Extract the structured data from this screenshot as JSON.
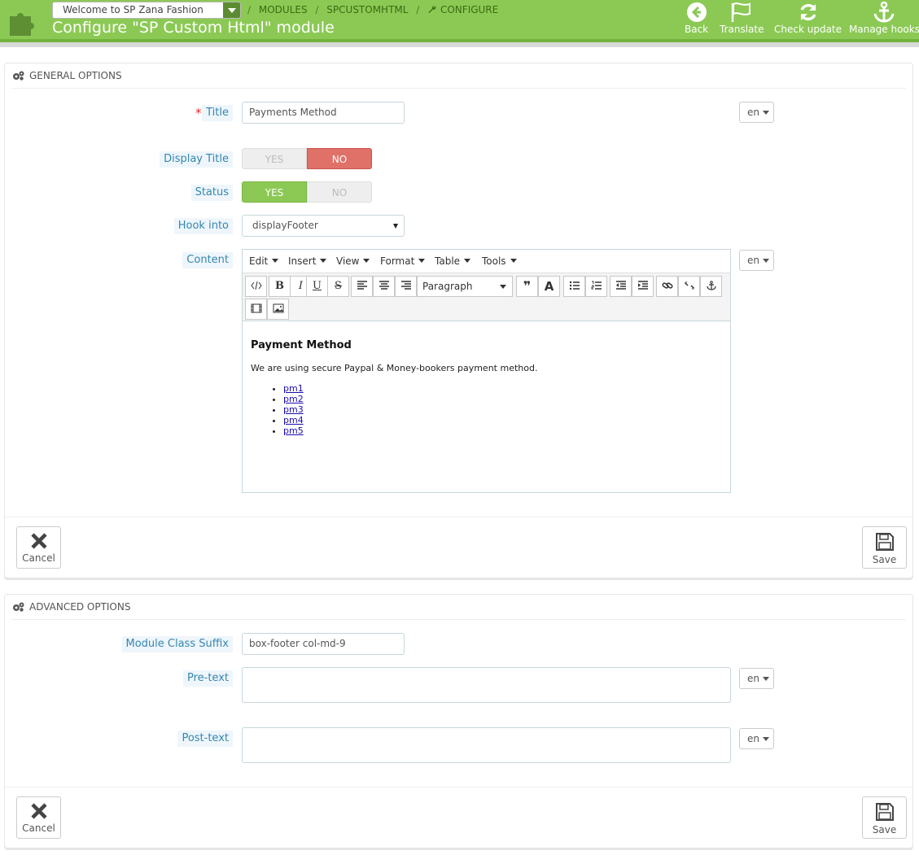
{
  "header": {
    "shop_selector": "Welcome to SP Zana Fashion",
    "breadcrumb": [
      "MODULES",
      "SPCUSTOMHTML",
      "CONFIGURE"
    ],
    "title": "Configure \"SP Custom Html\" module",
    "toolbar": {
      "back": "Back",
      "translate": "Translate",
      "check_update": "Check update",
      "manage_hooks": "Manage hooks"
    }
  },
  "general": {
    "heading": "GENERAL OPTIONS",
    "required_mark": "*",
    "title_label": "Title",
    "title_value": "Payments Method",
    "lang": "en",
    "display_title_label": "Display Title",
    "status_label": "Status",
    "yes": "YES",
    "no": "NO",
    "display_title_value": "NO",
    "status_value": "YES",
    "hook_label": "Hook into",
    "hook_value": "displayFooter",
    "content_label": "Content",
    "editor": {
      "menu": [
        "Edit",
        "Insert",
        "View",
        "Format",
        "Table",
        "Tools"
      ],
      "paragraph": "Paragraph",
      "heading": "Payment Method",
      "text": "We are using secure Paypal & Money-bookers payment method.",
      "links": [
        "pm1",
        "pm2",
        "pm3",
        "pm4",
        "pm5"
      ]
    },
    "cancel": "Cancel",
    "save": "Save"
  },
  "advanced": {
    "heading": "ADVANCED OPTIONS",
    "suffix_label": "Module Class Suffix",
    "suffix_value": "box-footer col-md-9",
    "pretext_label": "Pre-text",
    "posttext_label": "Post-text",
    "lang": "en",
    "cancel": "Cancel",
    "save": "Save"
  }
}
